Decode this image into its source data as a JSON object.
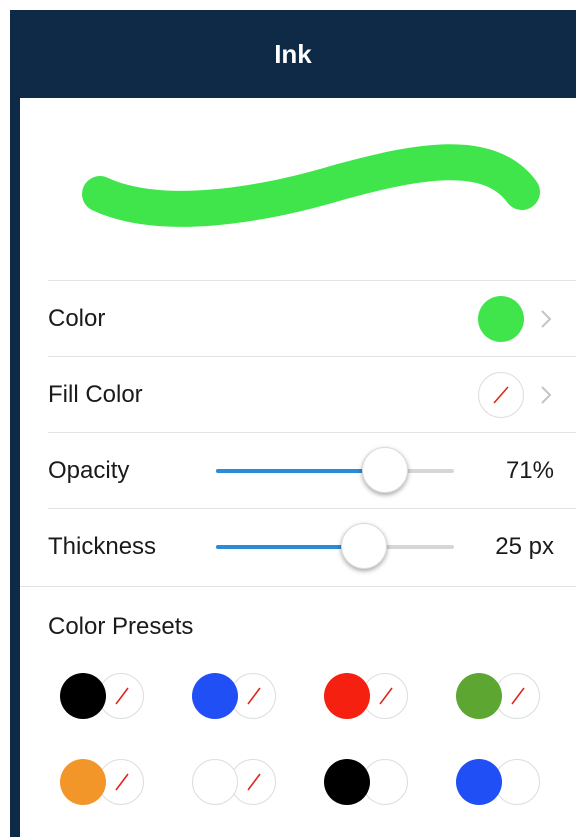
{
  "header": {
    "title": "Ink"
  },
  "preview": {
    "stroke_color": "#3fe54a"
  },
  "rows": {
    "color": {
      "label": "Color",
      "value_color": "#3fe54a"
    },
    "fill_color": {
      "label": "Fill Color",
      "value": "none"
    },
    "opacity": {
      "label": "Opacity",
      "value": "71%",
      "fraction": 0.71
    },
    "thickness": {
      "label": "Thickness",
      "value": "25 px",
      "fraction": 0.62
    }
  },
  "presets": {
    "title": "Color Presets",
    "items": [
      {
        "stroke": "#000000",
        "fill": "none"
      },
      {
        "stroke": "#1f4ff5",
        "fill": "none"
      },
      {
        "stroke": "#f5200f",
        "fill": "none"
      },
      {
        "stroke": "#5ea632",
        "fill": "none"
      },
      {
        "stroke": "#f3962a",
        "fill": "none"
      },
      {
        "stroke": "#ffffff",
        "fill": "none"
      },
      {
        "stroke": "#000000",
        "fill": "#ffffff"
      },
      {
        "stroke": "#1f4ff5",
        "fill": "#ffffff"
      }
    ]
  },
  "colors": {
    "header_bg": "#0f2a47",
    "accent": "#2a8bd6",
    "no_fill_slash": "#e0261c"
  },
  "icons": {
    "chevron": "chevron-right-icon",
    "no_fill": "no-fill-slash-icon"
  }
}
